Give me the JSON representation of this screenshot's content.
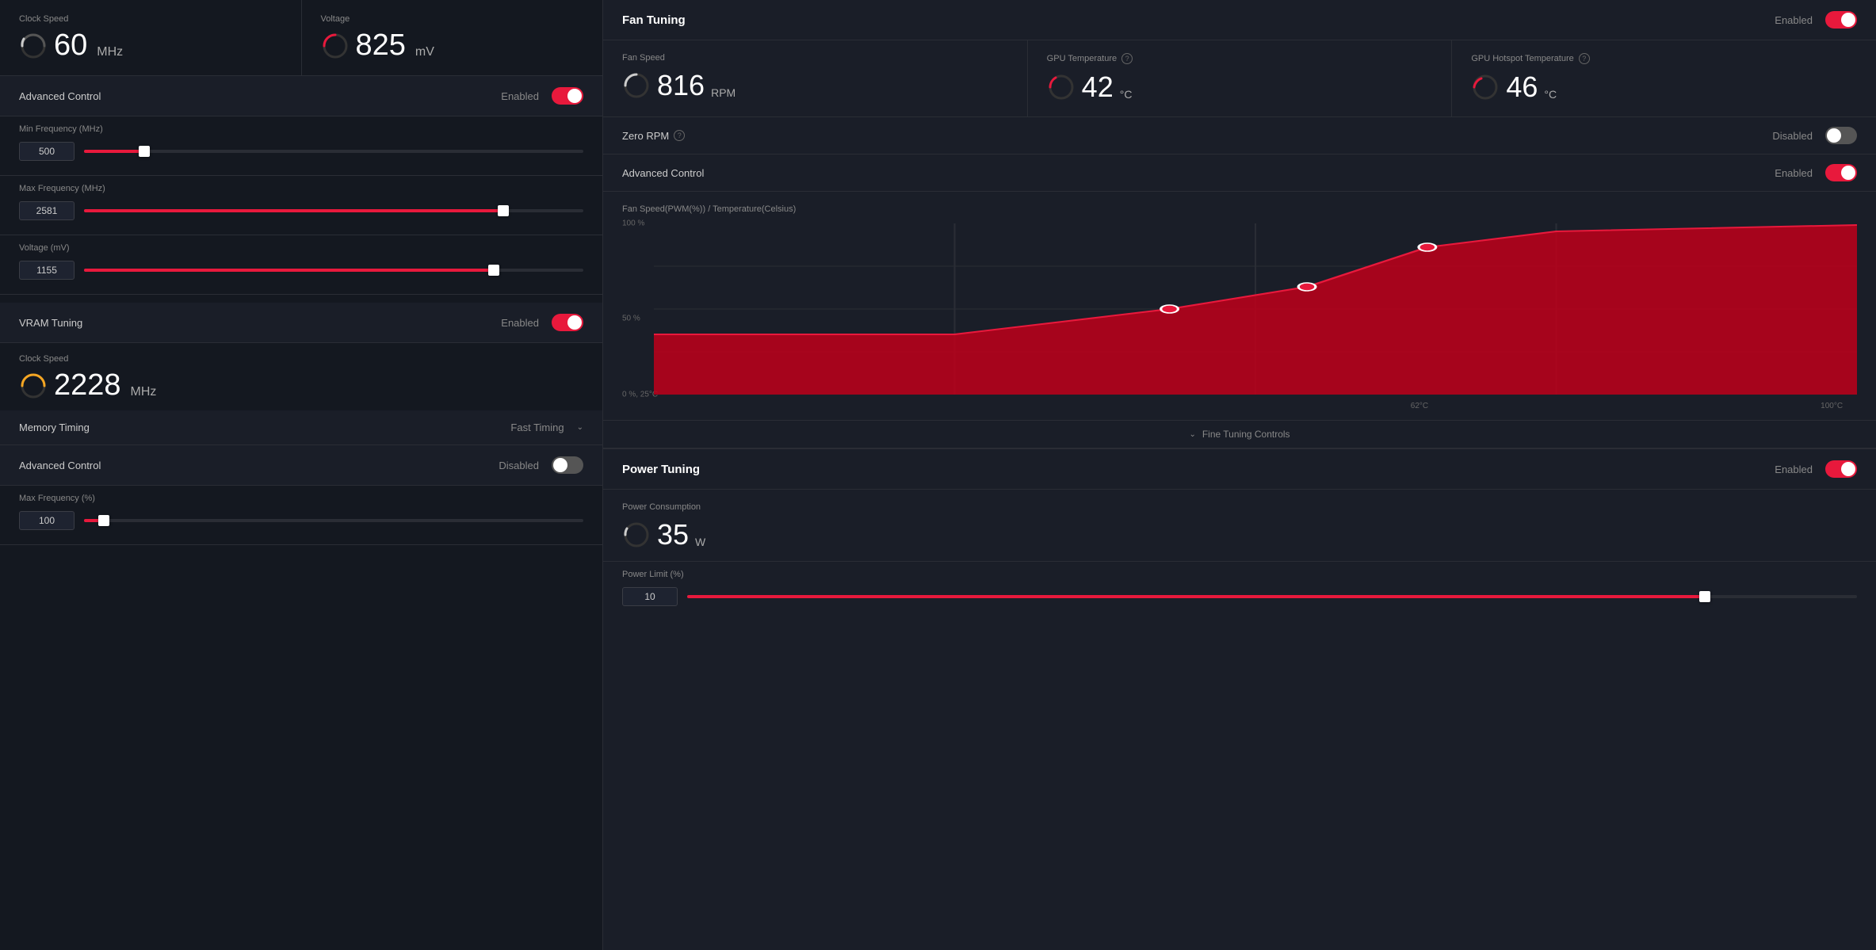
{
  "left": {
    "clockSpeed": {
      "label": "Clock Speed",
      "value": "60",
      "unit": "MHz"
    },
    "voltage": {
      "label": "Voltage",
      "value": "825",
      "unit": "mV"
    },
    "advancedControl": {
      "label": "Advanced Control",
      "status": "Enabled",
      "on": true
    },
    "minFrequency": {
      "label": "Min Frequency (MHz)",
      "value": "500",
      "percent": 12
    },
    "maxFrequency": {
      "label": "Max Frequency (MHz)",
      "value": "2581",
      "percent": 84
    },
    "voltageSlider": {
      "label": "Voltage (mV)",
      "value": "1155",
      "percent": 82
    },
    "vramTuning": {
      "label": "VRAM Tuning",
      "status": "Enabled",
      "on": true
    },
    "vramClock": {
      "label": "Clock Speed",
      "value": "2228",
      "unit": "MHz"
    },
    "memoryTiming": {
      "label": "Memory Timing",
      "value": "Fast Timing"
    },
    "vramAdvancedControl": {
      "label": "Advanced Control",
      "status": "Disabled",
      "on": false
    },
    "maxFrequencyPct": {
      "label": "Max Frequency (%)",
      "value": "100",
      "percent": 4
    }
  },
  "right": {
    "fanTuning": {
      "title": "Fan Tuning",
      "status": "Enabled",
      "on": true,
      "fanSpeed": {
        "label": "Fan Speed",
        "value": "816",
        "unit": "RPM"
      },
      "gpuTemp": {
        "label": "GPU Temperature",
        "value": "42",
        "unit": "°C"
      },
      "gpuHotspot": {
        "label": "GPU Hotspot Temperature",
        "value": "46",
        "unit": "°C"
      }
    },
    "zeroRPM": {
      "label": "Zero RPM",
      "status": "Disabled",
      "on": false
    },
    "fanAdvancedControl": {
      "label": "Advanced Control",
      "status": "Enabled",
      "on": true
    },
    "fanChart": {
      "label": "Fan Speed(PWM(%)) / Temperature(Celsius)",
      "yLabels": [
        "100 %",
        "50 %",
        "0 %, 25°C"
      ],
      "xLabels": [
        "62°C",
        "100°C"
      ]
    },
    "fineTuning": {
      "label": "Fine Tuning Controls"
    },
    "powerTuning": {
      "title": "Power Tuning",
      "status": "Enabled",
      "on": true,
      "consumption": {
        "label": "Power Consumption",
        "value": "35",
        "unit": "W"
      },
      "limit": {
        "label": "Power Limit (%)",
        "value": "10",
        "percent": 87
      }
    }
  }
}
